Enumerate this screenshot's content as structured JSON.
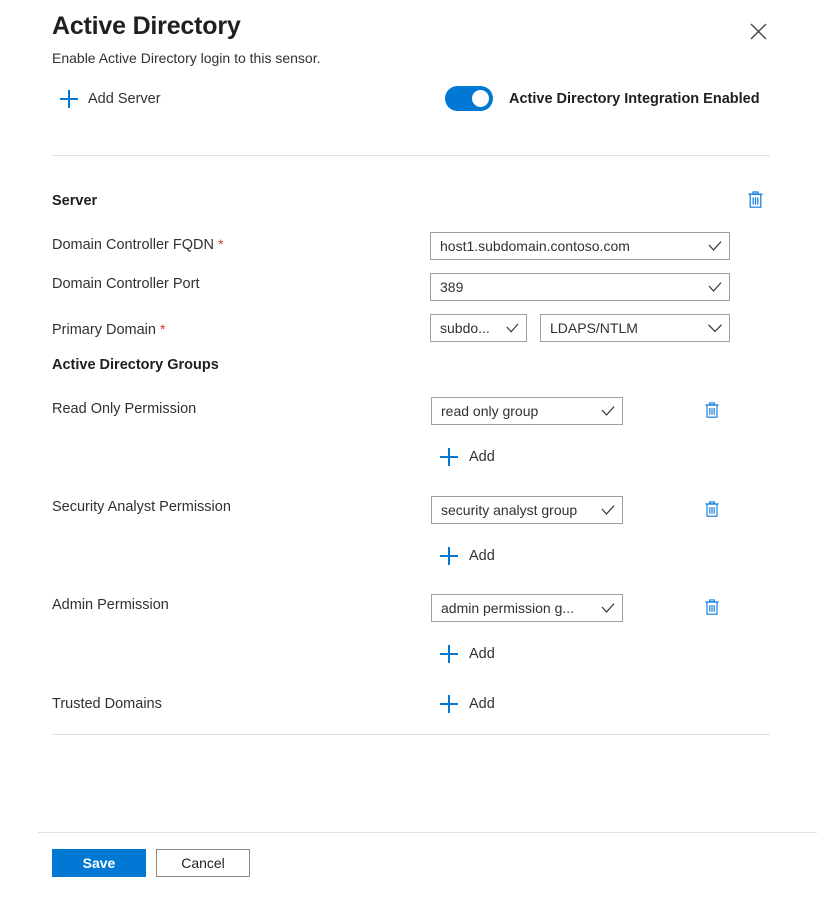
{
  "header": {
    "title": "Active Directory",
    "subtitle": "Enable Active Directory login to this sensor.",
    "close_icon": "close-icon",
    "add_server_label": "Add Server",
    "add_server_icon": "plus-icon"
  },
  "toggle": {
    "label": "Active Directory Integration Enabled",
    "enabled": true,
    "accent_color": "#0078d4"
  },
  "server_section": {
    "heading": "Server",
    "delete_icon": "trash-icon",
    "fields": [
      {
        "label": "Domain Controller FQDN",
        "required": true,
        "value": "host1.subdomain.contoso.com",
        "caret": "check-caret"
      },
      {
        "label": "Domain Controller Port",
        "required": false,
        "value": "389",
        "caret": "check-caret"
      }
    ],
    "primary_domain": {
      "label": "Primary Domain",
      "required": true,
      "domain_value": "subdo...",
      "domain_caret": "check-caret",
      "protocol_value": "LDAPS/NTLM",
      "protocol_caret": "chevron-down-icon"
    }
  },
  "groups_section": {
    "heading": "Active Directory Groups",
    "rows": [
      {
        "label": "Read Only Permission",
        "value": "read only group",
        "caret": "check-caret",
        "add_label": "Add",
        "delete_icon": "trash-icon"
      },
      {
        "label": "Security Analyst Permission",
        "value": "security analyst group",
        "caret": "check-caret",
        "add_label": "Add",
        "delete_icon": "trash-icon"
      },
      {
        "label": "Admin Permission",
        "value": "admin permission g...",
        "caret": "check-caret",
        "add_label": "Add",
        "delete_icon": "trash-icon"
      }
    ],
    "trusted_domains": {
      "label": "Trusted Domains",
      "add_label": "Add"
    }
  },
  "footer": {
    "save_label": "Save",
    "cancel_label": "Cancel",
    "primary_color": "#0078d4"
  }
}
